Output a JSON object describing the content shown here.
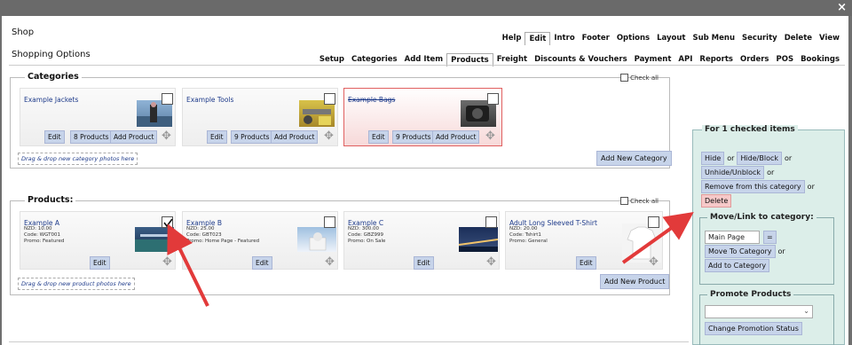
{
  "window": {
    "close": "×"
  },
  "app": {
    "title": "Shop",
    "subtitle": "Shopping Options"
  },
  "menu_top": [
    "Help",
    "Edit",
    "Intro",
    "Footer",
    "Options",
    "Layout",
    "Sub Menu",
    "Security",
    "Delete",
    "View"
  ],
  "menu_top_active": "Edit",
  "menu_tabs": [
    "Setup",
    "Categories",
    "Add Item",
    "Products",
    "Freight",
    "Discounts & Vouchers",
    "Payment",
    "API",
    "Reports",
    "Orders",
    "POS",
    "Bookings"
  ],
  "menu_tabs_active": "Products",
  "categories": {
    "legend": "Categories",
    "check_all": "Check all",
    "items": [
      {
        "name": "Example Jackets",
        "count_label": "8 Products"
      },
      {
        "name": "Example Tools",
        "count_label": "9 Products"
      },
      {
        "name": "Example Bags",
        "count_label": "9 Products"
      }
    ],
    "edit_label": "Edit",
    "add_product_label": "Add Product",
    "drop_hint": "Drag & drop new category photos here",
    "add_new_label": "Add New Category"
  },
  "products": {
    "legend": "Products:",
    "check_all": "Check all",
    "items": [
      {
        "name": "Example A",
        "price": "NZD: 10.00",
        "code": "Code: WGT001",
        "promo": "Promo: Featured"
      },
      {
        "name": "Example B",
        "price": "NZD: 25.00",
        "code": "Code: GBT023",
        "promo": "Promo: Home Page - Featured"
      },
      {
        "name": "Example C",
        "price": "NZD: 300.00",
        "code": "Code: GBZ999",
        "promo": "Promo: On Sale"
      },
      {
        "name": "Adult Long Sleeved T-Shirt",
        "price": "NZD: 20.00",
        "code": "Code: Tshirt1",
        "promo": "Promo: General"
      }
    ],
    "edit_label": "Edit",
    "drop_hint": "Drag & drop new product photos here",
    "add_new_label": "Add New Product"
  },
  "side": {
    "legend": "For 1 checked items",
    "hide": "Hide",
    "or": "or",
    "hide_block": "Hide/Block",
    "unhide_unblock": "Unhide/Unblock",
    "remove_category": "Remove from this category",
    "delete": "Delete",
    "move_legend": "Move/Link to category:",
    "category_value": "Main Page",
    "eq": "=",
    "move_to": "Move To Category",
    "add_to": "Add to Category",
    "promote_legend": "Promote Products",
    "promote_select": "",
    "change_promo": "Change Promotion Status"
  },
  "colors": {
    "accent": "#c7d4ea",
    "panel": "#dceee9",
    "danger": "#e03a3a",
    "highlight": "#f6c9c9"
  }
}
